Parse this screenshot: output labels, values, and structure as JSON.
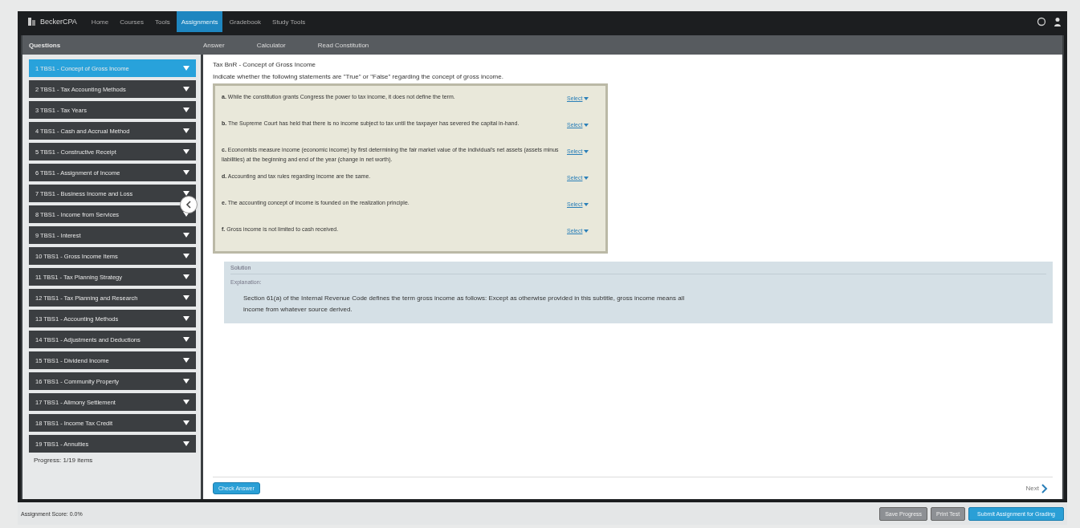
{
  "nav": {
    "logo": "BeckerCPA",
    "items": [
      {
        "label": "Home",
        "selected": false
      },
      {
        "label": "Courses",
        "selected": false
      },
      {
        "label": "Tools",
        "selected": false
      },
      {
        "label": "Assignments",
        "selected": true
      },
      {
        "label": "Gradebook",
        "selected": false
      },
      {
        "label": "Study Tools",
        "selected": false
      }
    ]
  },
  "sidebar": {
    "title": "Questions",
    "items": [
      {
        "label": "1 TBS1 - Concept of Gross Income",
        "selected": true
      },
      {
        "label": "2 TBS1 - Tax Accounting Methods",
        "selected": false
      },
      {
        "label": "3 TBS1 - Tax Years",
        "selected": false
      },
      {
        "label": "4 TBS1 - Cash and Accrual Method",
        "selected": false
      },
      {
        "label": "5 TBS1 - Constructive Receipt",
        "selected": false
      },
      {
        "label": "6 TBS1 - Assignment of Income",
        "selected": false
      },
      {
        "label": "7 TBS1 - Business Income and Loss",
        "selected": false
      },
      {
        "label": "8 TBS1 - Income from Services",
        "selected": false
      },
      {
        "label": "9 TBS1 - Interest",
        "selected": false
      },
      {
        "label": "10 TBS1 - Gross Income Items",
        "selected": false
      },
      {
        "label": "11 TBS1 - Tax Planning Strategy",
        "selected": false
      },
      {
        "label": "12 TBS1 - Tax Planning and Research",
        "selected": false
      },
      {
        "label": "13 TBS1 - Accounting Methods",
        "selected": false
      },
      {
        "label": "14 TBS1 - Adjustments and Deductions",
        "selected": false
      },
      {
        "label": "15 TBS1 - Dividend Income",
        "selected": false
      },
      {
        "label": "16 TBS1 - Community Property",
        "selected": false
      },
      {
        "label": "17 TBS1 - Alimony Settlement",
        "selected": false
      },
      {
        "label": "18 TBS1 - Income Tax Credit",
        "selected": false
      },
      {
        "label": "19 TBS1 - Annuities",
        "selected": false
      }
    ],
    "progress": "Progress: 1/19 items"
  },
  "toolbar": [
    "Answer",
    "Calculator",
    "Read Constitution"
  ],
  "question": {
    "title": "Tax BnR - Concept of Gross Income",
    "instructions": "Indicate whether the following statements are \"True\" or \"False\" regarding the concept of gross income.",
    "statements": [
      {
        "letter": "a.",
        "text": "While the constitution grants Congress the power to tax income, it does not define the term.",
        "answer": "Select"
      },
      {
        "letter": "b.",
        "text": "The Supreme Court has held that there is no income subject to tax until the taxpayer has severed the capital in-hand.",
        "answer": "Select"
      },
      {
        "letter": "c.",
        "text": "Economists measure income (economic income) by first determining the fair market value of the individual's net assets (assets minus liabilities) at the beginning and end of the year (change in net worth).",
        "answer": "Select"
      },
      {
        "letter": "d.",
        "text": "Accounting and tax rules regarding income are the same.",
        "answer": "Select"
      },
      {
        "letter": "e.",
        "text": "The accounting concept of income is founded on the realization principle.",
        "answer": "Select"
      },
      {
        "letter": "f.",
        "text": "Gross income is not limited to cash received.",
        "answer": "Select"
      }
    ]
  },
  "solution": {
    "title": "Solution",
    "subtitle": "Explanation:",
    "text": "Section 61(a) of the Internal Revenue Code defines the term gross income as follows: Except as otherwise provided in this subtitle, gross income means all income from whatever source derived."
  },
  "actions": {
    "check": "Check Answer",
    "next": "Next"
  },
  "footer": {
    "score": "Assignment Score: 0.0%",
    "buttons": [
      {
        "label": "Save Progress",
        "kind": "secondary"
      },
      {
        "label": "Print Test",
        "kind": "secondary"
      },
      {
        "label": "Submit Assignment for Grading",
        "kind": "primary"
      }
    ]
  }
}
